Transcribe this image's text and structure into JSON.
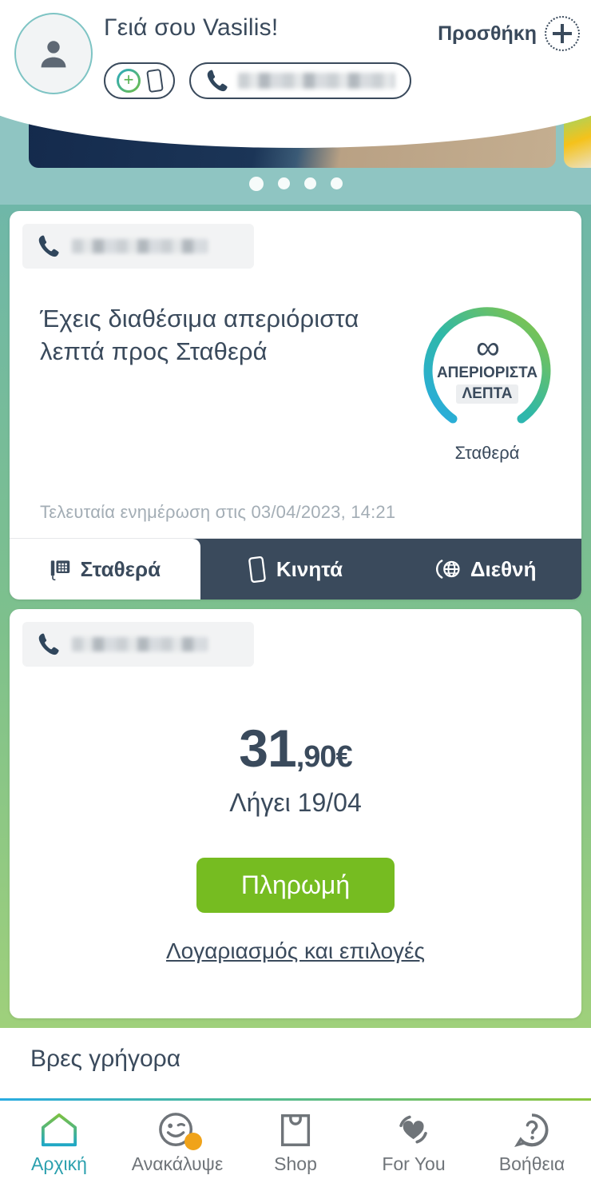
{
  "header": {
    "greeting": "Γειά σου Vasilis!",
    "add_label": "Προσθήκη",
    "avatar_icon": "person-icon",
    "add_icon": "plus-circle-dotted-icon",
    "chip_add_icon": "plus-gradient-icon",
    "chip_mobile_icon": "mobile-phone-icon",
    "chip_phone_icon": "phone-handset-icon",
    "chip_phone_number": ""
  },
  "carousel": {
    "dots": 4,
    "active_dot": 0
  },
  "card_usage": {
    "msisdn": "",
    "msisdn_icon": "phone-handset-icon",
    "title": "Έχεις διαθέσιμα απεριόριστα λεπτά προς Σταθερά",
    "gauge": {
      "symbol": "∞",
      "label": "ΑΠΕΡΙΟΡΙΣΤΑ",
      "unit": "ΛΕΠΤΑ",
      "sublabel": "Σταθερά",
      "ring_start_color": "#29abe2",
      "ring_end_color": "#8dc63f"
    },
    "last_update": "Τελευταία ενημέρωση στις 03/04/2023, 14:21",
    "tabs": [
      {
        "label": "Σταθερά",
        "icon": "deskphone-icon",
        "active": true
      },
      {
        "label": "Κινητά",
        "icon": "mobile-phone-icon",
        "active": false
      },
      {
        "label": "Διεθνή",
        "icon": "globe-call-icon",
        "active": false
      }
    ]
  },
  "card_bill": {
    "msisdn": "",
    "msisdn_icon": "phone-handset-icon",
    "amount_int": "31",
    "amount_dec": ",90€",
    "expires": "Λήγει 19/04",
    "pay_label": "Πληρωμή",
    "account_link": "Λογαριασμός και επιλογές",
    "pay_color": "#76bc21"
  },
  "find_quickly": {
    "title": "Βρες γρήγορα"
  },
  "bottom_nav": [
    {
      "label": "Αρχική",
      "icon": "home-icon",
      "active": true,
      "badge": false
    },
    {
      "label": "Ανακάλυψε",
      "icon": "wink-smiley-icon",
      "active": false,
      "badge": true
    },
    {
      "label": "Shop",
      "icon": "shopping-bag-icon",
      "active": false,
      "badge": false
    },
    {
      "label": "For You",
      "icon": "heart-loop-icon",
      "active": false,
      "badge": false
    },
    {
      "label": "Βοήθεια",
      "icon": "question-bubble-icon",
      "active": false,
      "badge": false
    }
  ]
}
